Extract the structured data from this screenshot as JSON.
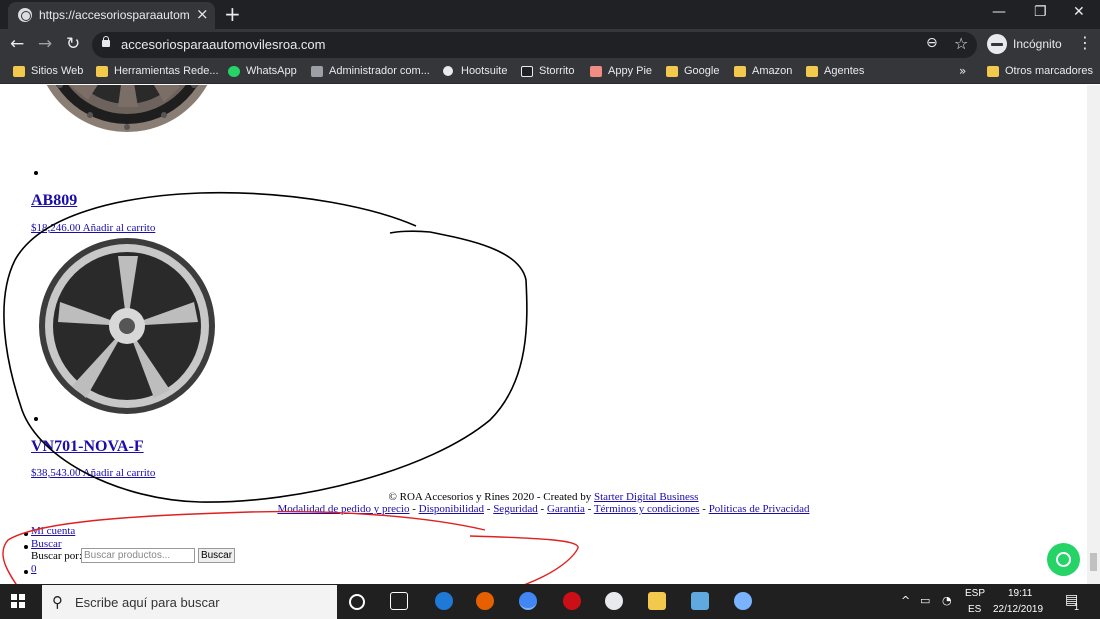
{
  "browser": {
    "tab_title": "https://accesoriosparaautomoviles",
    "tab_close": "×",
    "new_tab": "+",
    "window_minimize": "—",
    "window_restore": "❐",
    "window_close": "✕",
    "back": "←",
    "forward": "→",
    "reload": "↻",
    "url": "accesoriosparaautomovilesroa.com",
    "zoom": "⊖",
    "star": "☆",
    "profile_label": "Incógnito",
    "menu": "⋮"
  },
  "bookmarks": {
    "items": [
      {
        "label": "Sitios Web",
        "icon": "folder-icon"
      },
      {
        "label": "Herramientas Rede...",
        "icon": "folder-icon"
      },
      {
        "label": "WhatsApp",
        "icon": "whatsapp-icon"
      },
      {
        "label": "Administrador com...",
        "icon": "admin-icon"
      },
      {
        "label": "Hootsuite",
        "icon": "hootsuite-icon"
      },
      {
        "label": "Storrito",
        "icon": "storrito-icon"
      },
      {
        "label": "Appy Pie",
        "icon": "appypie-icon"
      },
      {
        "label": "Google",
        "icon": "folder-icon"
      },
      {
        "label": "Amazon",
        "icon": "folder-icon"
      },
      {
        "label": "Agentes",
        "icon": "folder-icon"
      }
    ],
    "more": "»",
    "other": "Otros marcadores"
  },
  "products": [
    {
      "name": "AB809",
      "price": "$18,246.00",
      "cart": "Añadir al carrito"
    },
    {
      "name": "VN701-NOVA-F",
      "price": "$38,543.00",
      "cart": "Añadir al carrito"
    }
  ],
  "footer": {
    "copyright": "© ROA Accesorios y Rines 2020 - Created by ",
    "credit_link": "Starter Digital Business",
    "links": [
      "Modalidad de pedido y precio",
      "Disponibilidad",
      "Seguridad",
      "Garantia",
      "Términos y condiciones",
      "Politicas de Privacidad"
    ],
    "separator": " - "
  },
  "menu": {
    "account": "Mi cuenta",
    "search_link": "Buscar",
    "search_label": "Buscar por:",
    "search_placeholder": "Buscar productos...",
    "search_button": "Buscar",
    "cart_count": "0"
  },
  "taskbar": {
    "search_placeholder": "Escribe aquí para buscar",
    "lang_top": "ESP",
    "lang_bottom": "ES",
    "time": "19:11",
    "date": "22/12/2019",
    "notification_count": "1"
  },
  "colors": {
    "link": "#1a0dab",
    "annotation_black": "#000000",
    "annotation_red": "#e02020",
    "whatsapp": "#25d366"
  }
}
